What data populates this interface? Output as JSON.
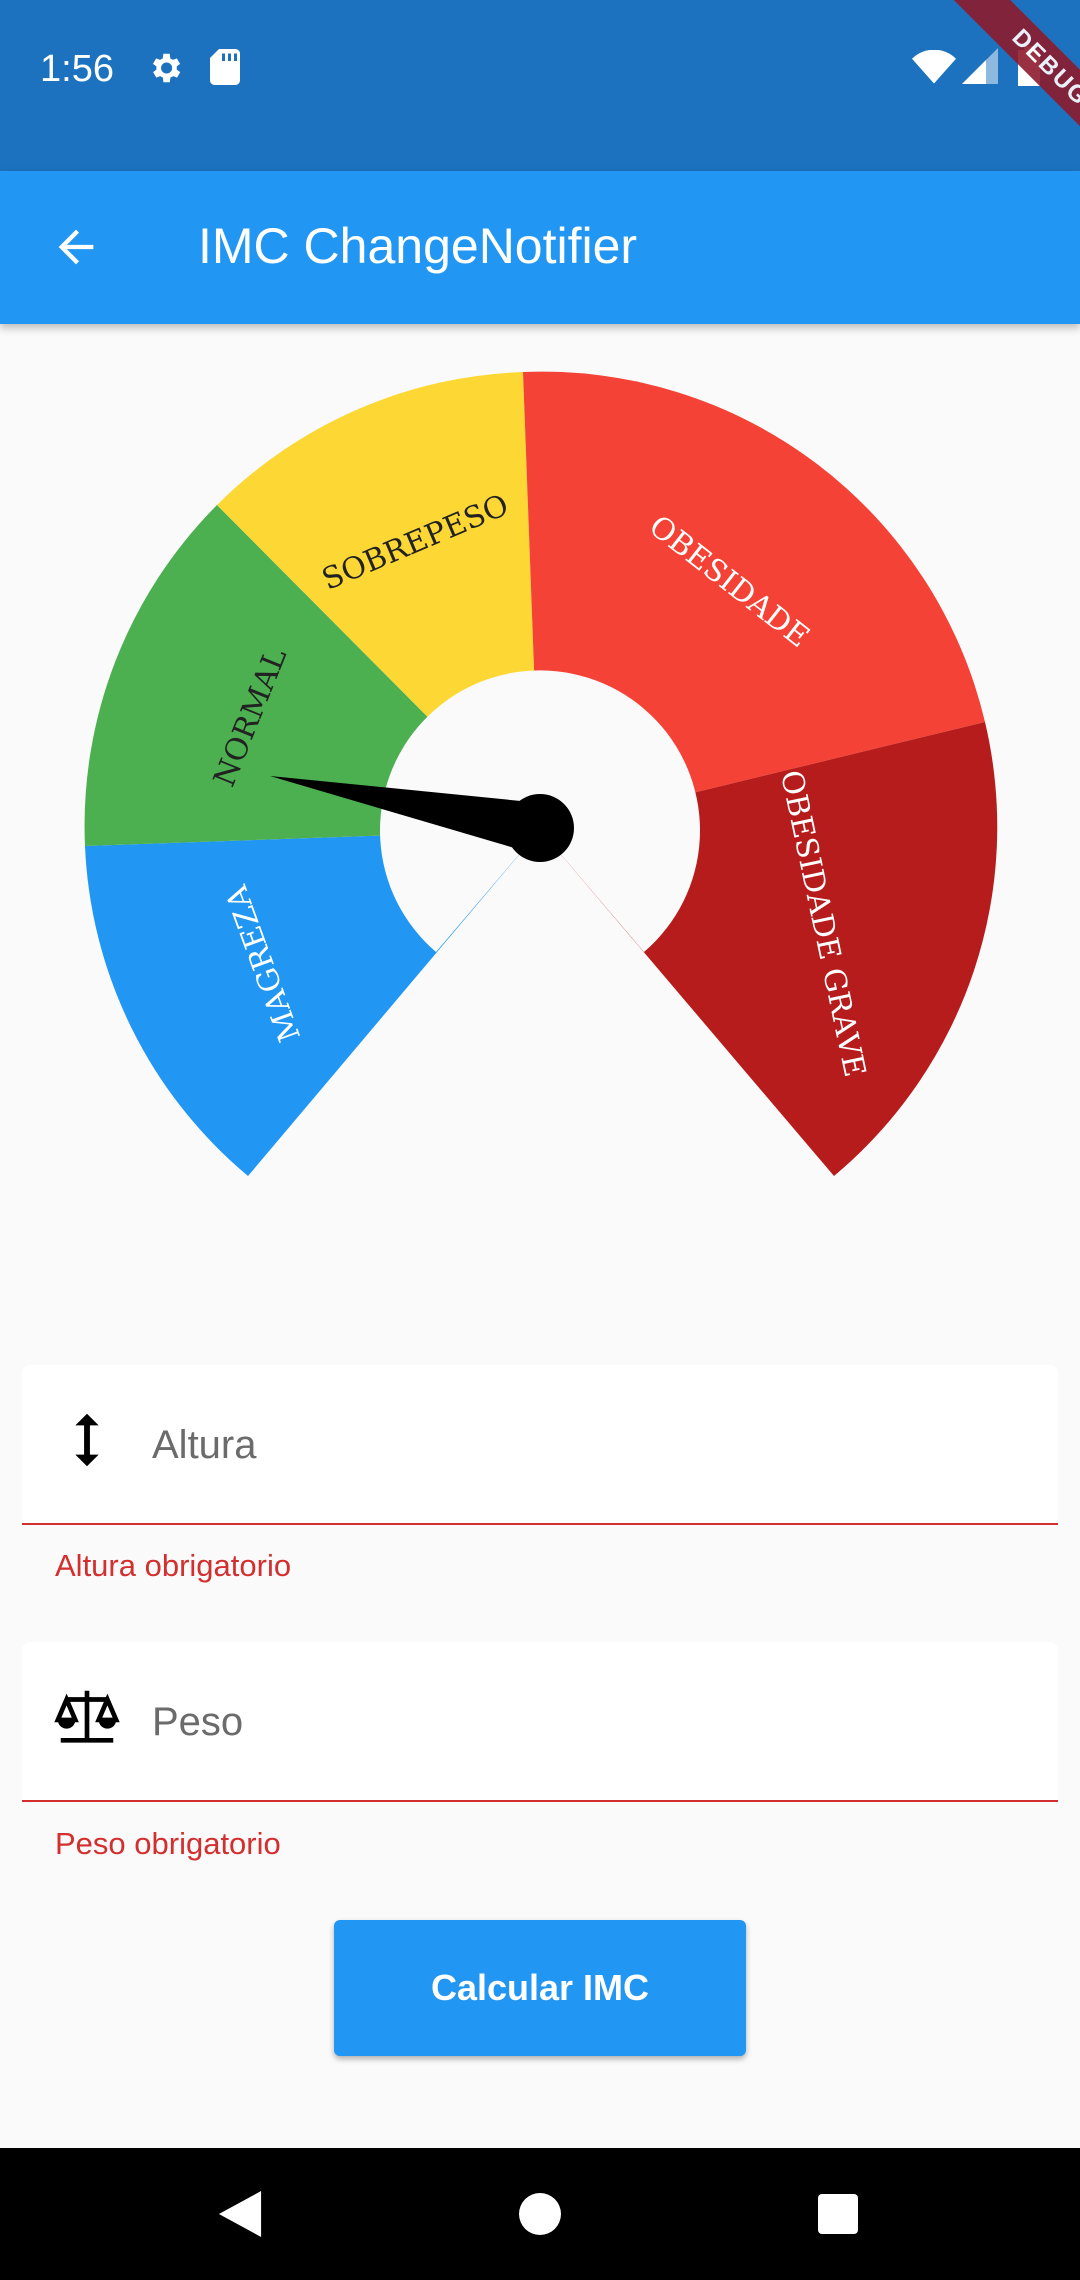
{
  "status_bar": {
    "time": "1:56",
    "icons": [
      "gear-icon",
      "sd-card-icon",
      "wifi-icon",
      "signal-icon",
      "battery-icon"
    ],
    "debug_label": "DEBUG"
  },
  "app_bar": {
    "title": "IMC ChangeNotifier",
    "back_icon": "arrow-back-icon",
    "color": "#2196f3"
  },
  "gauge": {
    "segments": [
      {
        "label": "MAGREZA",
        "color": "#2196f3"
      },
      {
        "label": "NORMAL",
        "color": "#4caf50"
      },
      {
        "label": "SOBREPESO",
        "color": "#fdd835"
      },
      {
        "label": "OBESIDADE",
        "color": "#f44336"
      },
      {
        "label": "OBESIDADE GRAVE",
        "color": "#b71c1c"
      }
    ],
    "needle_color": "#000000"
  },
  "form": {
    "altura": {
      "placeholder": "Altura",
      "error": "Altura obrigatorio",
      "icon": "vertical-arrows-icon"
    },
    "peso": {
      "placeholder": "Peso",
      "error": "Peso obrigatorio",
      "icon": "scale-icon"
    },
    "error_color": "#d32f2f"
  },
  "button": {
    "label": "Calcular IMC"
  },
  "nav_bar": {
    "icons": [
      "back-triangle-icon",
      "home-circle-icon",
      "recents-square-icon"
    ]
  }
}
